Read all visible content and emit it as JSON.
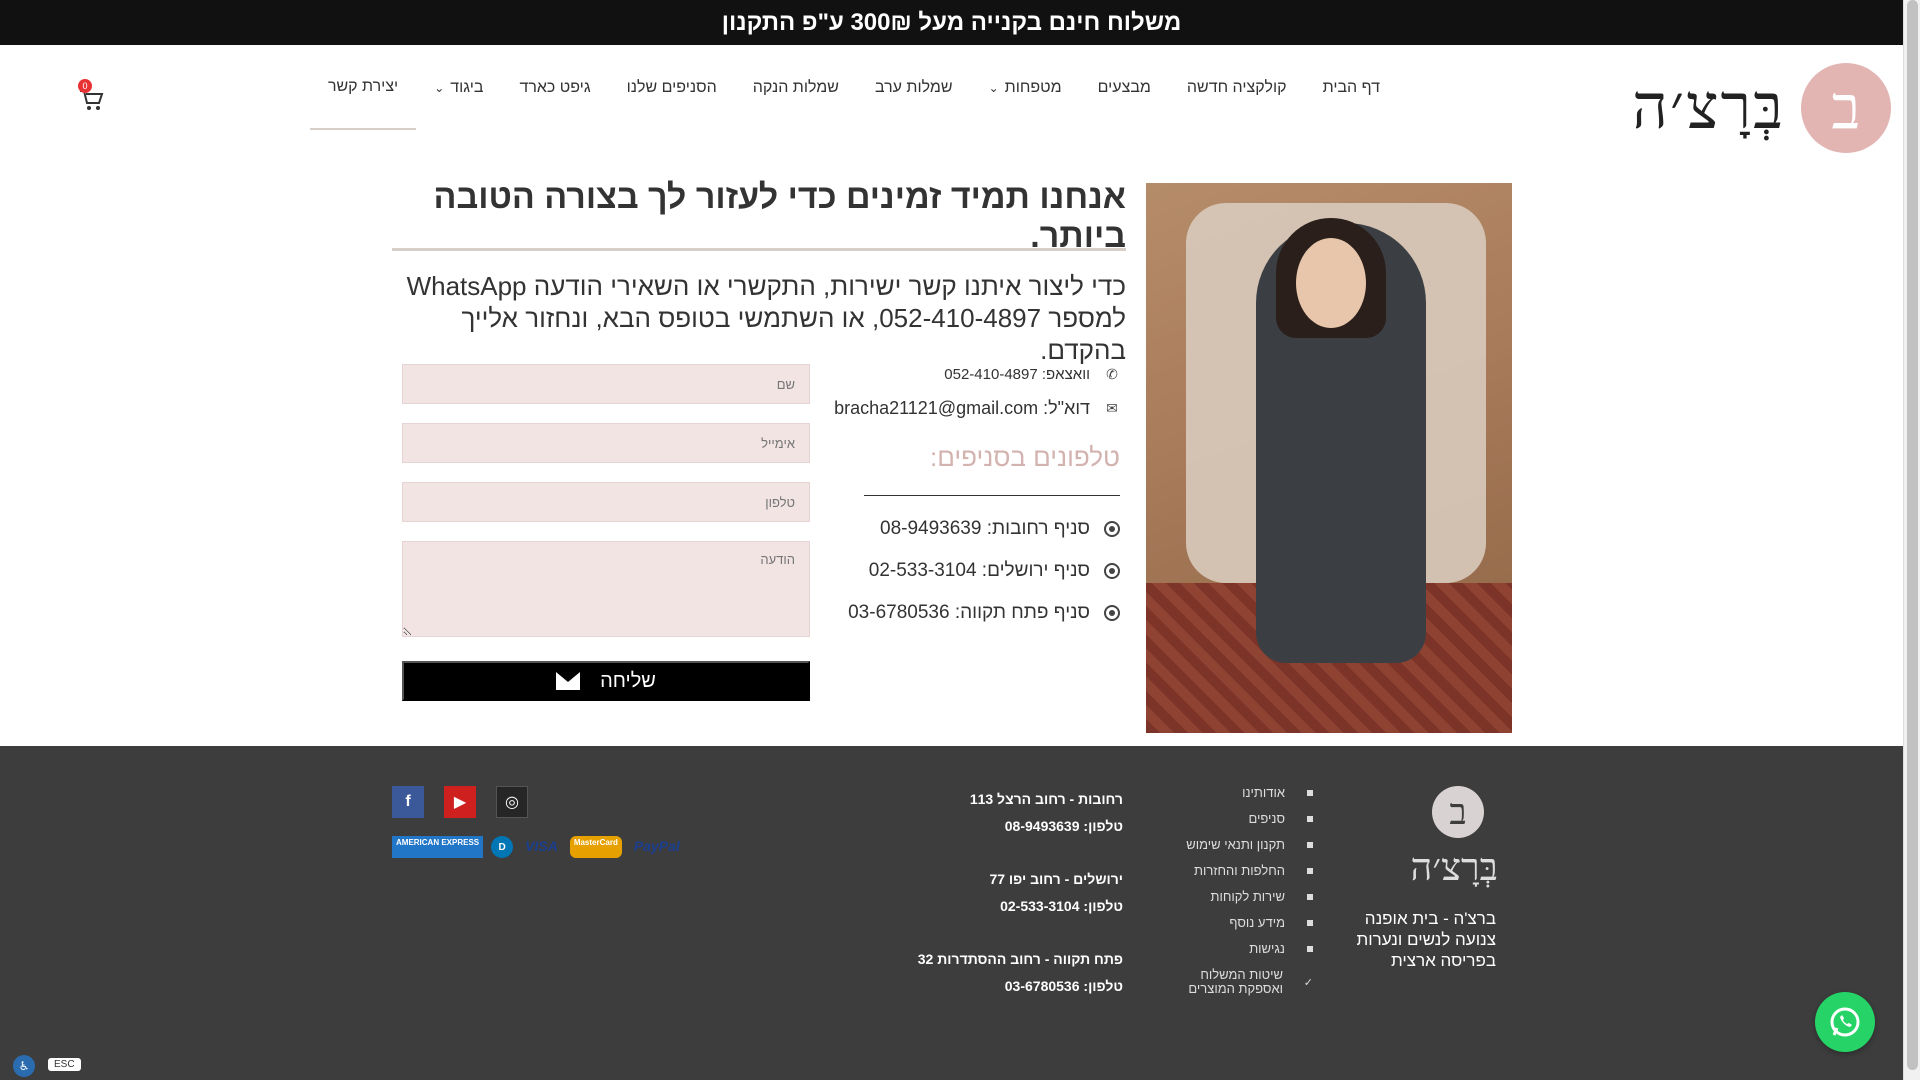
{
  "topbar": {
    "text": "משלוח חינם בקנייה מעל 300₪ ע\"פ התקנון"
  },
  "logo": {
    "letter": "ב",
    "text": "בְּרָצ׳ה"
  },
  "nav": {
    "items": [
      {
        "label": "דף הבית"
      },
      {
        "label": "קולקציה חדשה"
      },
      {
        "label": "מבצעים"
      },
      {
        "label": "מטפחות",
        "dropdown": true
      },
      {
        "label": "שמלות ערב"
      },
      {
        "label": "שמלות הנקה"
      },
      {
        "label": "הסניפים שלנו"
      },
      {
        "label": "גיפט כארד"
      },
      {
        "label": "ביגוד",
        "dropdown": true
      },
      {
        "label": "יצירת קשר",
        "active": true
      }
    ],
    "cart_count": "0"
  },
  "content": {
    "heading": "אנחנו תמיד זמינים כדי לעזור לך בצורה הטובה ביותר.",
    "intro": "כדי ליצור איתנו קשר ישירות, התקשרי או השאירי הודעה WhatsApp למספר 052-410-4897, או השתמשי בטופס הבא, ונחזור אלייך בהקדם.",
    "whatsapp": "וואצאפ: 052-410-4897",
    "email": "דוא\"ל: bracha21121@gmail.com",
    "branches_title": "טלפונים בסניפים:",
    "branches": [
      {
        "label": "סניף רחובות: 08-9493639"
      },
      {
        "label": "סניף ירושלים: 02-533-3104"
      },
      {
        "label": "סניף פתח תקווה: 03-6780536"
      }
    ]
  },
  "form": {
    "name_placeholder": "שם",
    "email_placeholder": "אימייל",
    "phone_placeholder": "טלפון",
    "message_placeholder": "הודעה",
    "submit_label": "שליחה"
  },
  "footer": {
    "logo_letter": "ב",
    "logo_text": "בְּרָצ׳ה",
    "description": "ברצ'ה - בית אופנה צנועה לנשים ונערות בפריסה ארצית",
    "links": [
      {
        "label": "אודותינו"
      },
      {
        "label": "סניפים"
      },
      {
        "label": "תקנון ותנאי שימוש"
      },
      {
        "label": "החלפות והחזרות"
      },
      {
        "label": "שירות לקוחות"
      },
      {
        "label": "מידע נוסף"
      },
      {
        "label": "נגישות"
      },
      {
        "label": "שיטות המשלוח ואספקת המוצרים"
      }
    ],
    "branches": [
      {
        "address": "רחובות - רחוב הרצל 113",
        "phone": "טלפון: 08-9493639"
      },
      {
        "address": "ירושלים - רחוב יפו 77",
        "phone": "טלפון: 02-533-3104"
      },
      {
        "address": "פתח תקווה - רחוב ההסתדרות 32",
        "phone": "טלפון: 03-6780536"
      }
    ],
    "social": {
      "facebook": "f",
      "youtube": "▶",
      "instagram": "◎"
    },
    "payments": {
      "paypal": "PayPal",
      "mastercard": "MasterCard",
      "visa": "VISA",
      "diners": "D",
      "amex": "AMERICAN EXPRESS"
    }
  },
  "widgets": {
    "esc": "ESC"
  }
}
